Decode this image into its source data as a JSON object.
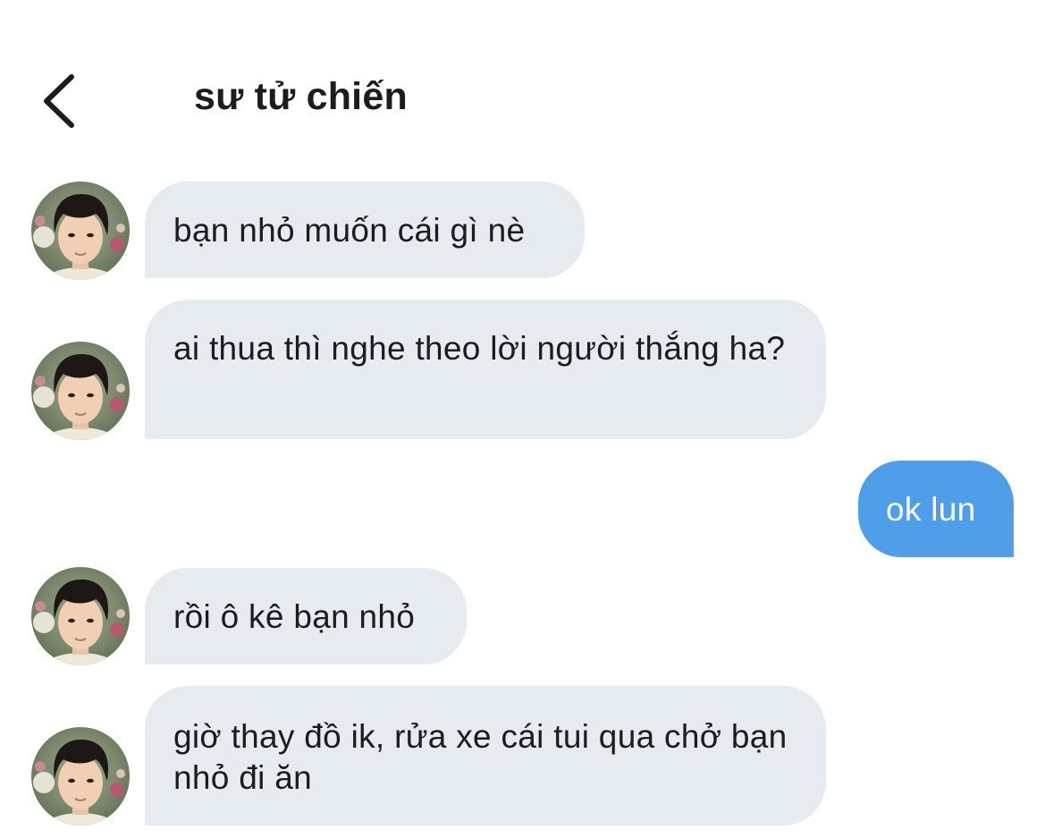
{
  "header": {
    "title": "sư tử chiến",
    "back_icon": "chevron-left-icon"
  },
  "conversation": {
    "messages": [
      {
        "direction": "incoming",
        "text": "bạn nhỏ muốn cái gì nè"
      },
      {
        "direction": "incoming",
        "text": "ai thua thì nghe theo lời người thắng ha?"
      },
      {
        "direction": "outgoing",
        "text": "ok lun"
      },
      {
        "direction": "incoming",
        "text": "rồi ô kê bạn nhỏ"
      },
      {
        "direction": "incoming",
        "text": "giờ thay đồ ik, rửa xe cái tui qua chở bạn nhỏ đi ăn"
      }
    ]
  },
  "colors": {
    "incoming_bubble": "#e6ebf0",
    "outgoing_bubble": "#4f9eea",
    "text_dark": "#1c1c1e"
  }
}
